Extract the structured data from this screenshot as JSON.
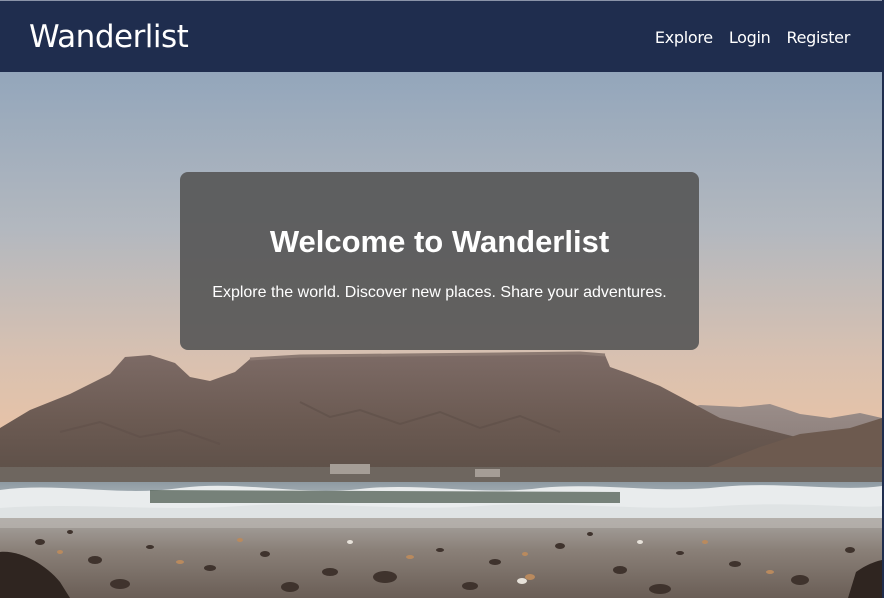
{
  "navbar": {
    "brand": "Wanderlist",
    "links": [
      {
        "label": "Explore"
      },
      {
        "label": "Login"
      },
      {
        "label": "Register"
      }
    ],
    "background_color": "#1f2d4e"
  },
  "hero": {
    "image_subject": "mountain-beach-landscape-photo",
    "card": {
      "title": "Welcome to Wanderlist",
      "subtitle": "Explore the world. Discover new places. Share your adventures."
    }
  }
}
